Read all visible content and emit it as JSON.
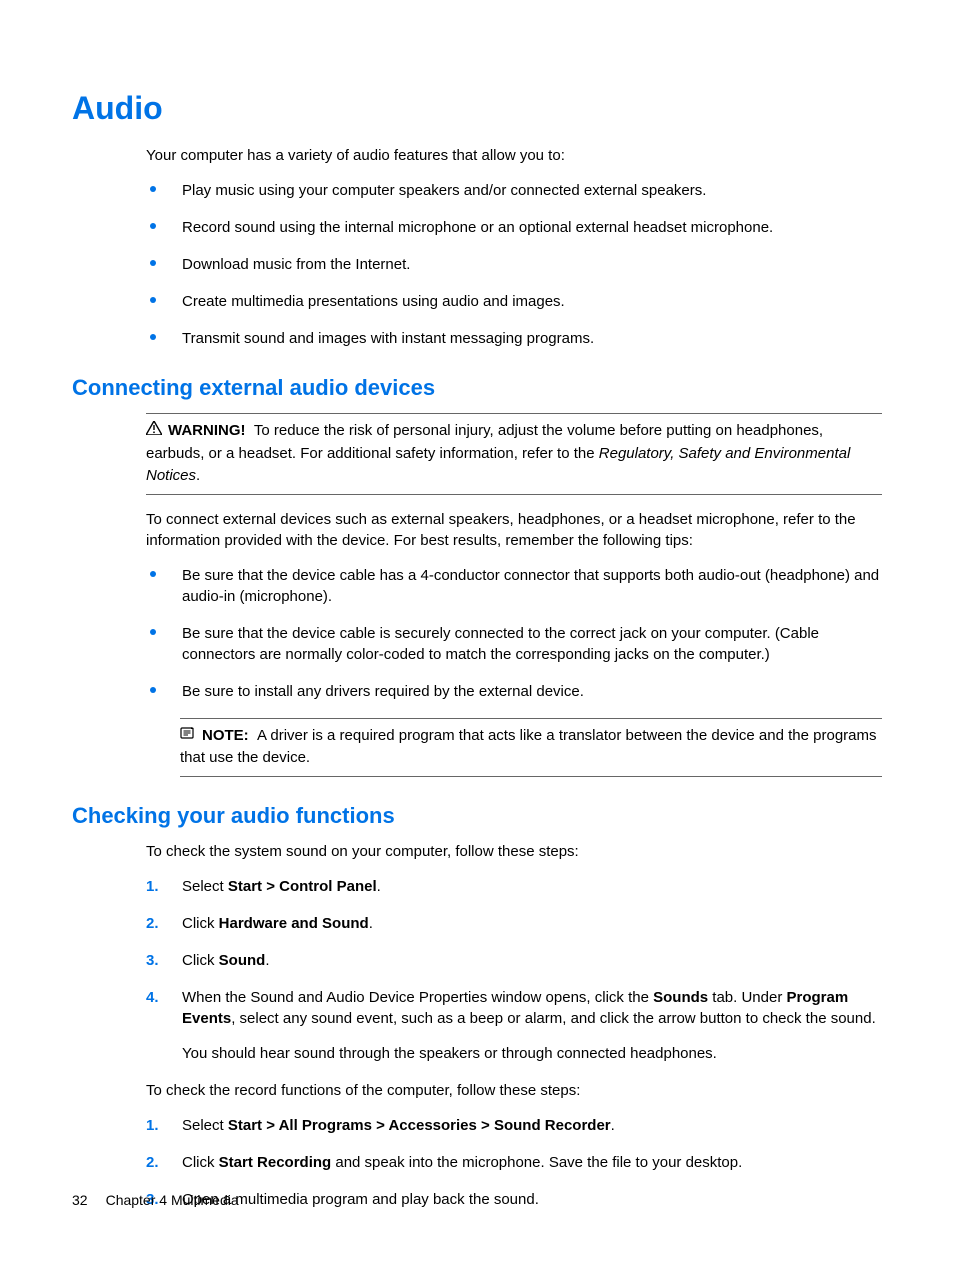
{
  "h1": "Audio",
  "intro": "Your computer has a variety of audio features that allow you to:",
  "features": [
    "Play music using your computer speakers and/or connected external speakers.",
    "Record sound using the internal microphone or an optional external headset microphone.",
    "Download music from the Internet.",
    "Create multimedia presentations using audio and images.",
    "Transmit sound and images with instant messaging programs."
  ],
  "section1": {
    "heading": "Connecting external audio devices",
    "warning_label": "WARNING!",
    "warning_text_1": "To reduce the risk of personal injury, adjust the volume before putting on headphones, earbuds, or a headset. For additional safety information, refer to the ",
    "warning_italic": "Regulatory, Safety and Environmental Notices",
    "warning_text_2": ".",
    "para": "To connect external devices such as external speakers, headphones, or a headset microphone, refer to the information provided with the device. For best results, remember the following tips:",
    "tips": [
      "Be sure that the device cable has a 4-conductor connector that supports both audio-out (headphone) and audio-in (microphone).",
      "Be sure that the device cable is securely connected to the correct jack on your computer. (Cable connectors are normally color-coded to match the corresponding jacks on the computer.)",
      "Be sure to install any drivers required by the external device."
    ],
    "note_label": "NOTE:",
    "note_text": "A driver is a required program that acts like a translator between the device and the programs that use the device."
  },
  "section2": {
    "heading": "Checking your audio functions",
    "para1": "To check the system sound on your computer, follow these steps:",
    "steps1": {
      "s1_a": "Select ",
      "s1_b": "Start > Control Panel",
      "s1_c": ".",
      "s2_a": "Click ",
      "s2_b": "Hardware and Sound",
      "s2_c": ".",
      "s3_a": "Click ",
      "s3_b": "Sound",
      "s3_c": ".",
      "s4_a": "When the Sound and Audio Device Properties window opens, click the ",
      "s4_b": "Sounds",
      "s4_c": " tab. Under ",
      "s4_d": "Program Events",
      "s4_e": ", select any sound event, such as a beep or alarm, and click the arrow button to check the sound.",
      "s4_sub": "You should hear sound through the speakers or through connected headphones."
    },
    "para2": "To check the record functions of the computer, follow these steps:",
    "steps2": {
      "s1_a": "Select ",
      "s1_b": "Start > All Programs > Accessories > Sound Recorder",
      "s1_c": ".",
      "s2_a": "Click ",
      "s2_b": "Start Recording",
      "s2_c": " and speak into the microphone. Save the file to your desktop.",
      "s3": "Open a multimedia program and play back the sound."
    }
  },
  "footer": {
    "page": "32",
    "chapter": "Chapter 4   Multimedia"
  }
}
